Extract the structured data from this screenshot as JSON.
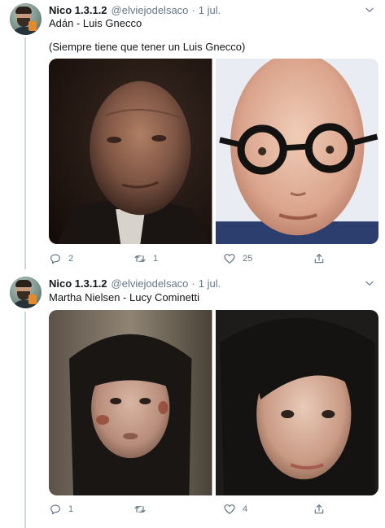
{
  "tweets": [
    {
      "author_name": "Nico 1.3.1.2",
      "handle": "@elviejodelsaco",
      "separator": "·",
      "time": "1 jul.",
      "text_line_1": "Adán - Luis Gnecco",
      "text_line_2": "(Siempre tiene que tener un Luis Gnecco)",
      "photos": [
        "character-adan-photo",
        "actor-luis-gnecco-photo"
      ],
      "actions": {
        "replies": "2",
        "retweets": "1",
        "likes": "25"
      }
    },
    {
      "author_name": "Nico 1.3.1.2",
      "handle": "@elviejodelsaco",
      "separator": "·",
      "time": "1 jul.",
      "text_line_1": "Martha Nielsen - Lucy Cominetti",
      "photos": [
        "character-martha-nielsen-photo",
        "actor-lucy-cominetti-photo"
      ],
      "actions": {
        "replies": "1",
        "retweets": "",
        "likes": "4"
      }
    }
  ],
  "icons": {
    "reply": "reply-icon",
    "retweet": "retweet-icon",
    "like": "heart-icon",
    "share": "share-icon",
    "menu": "chevron-down-icon"
  },
  "colors": {
    "name": "#14171a",
    "secondary": "#657786",
    "thread_line": "#ccd6dd",
    "divider": "#e6ecf0"
  }
}
